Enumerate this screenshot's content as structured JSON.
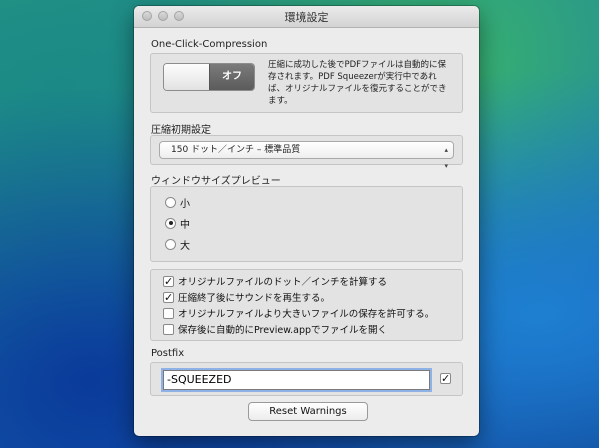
{
  "window": {
    "title": "環境設定"
  },
  "compression": {
    "label": "One-Click-Compression",
    "toggle_off": "オフ",
    "description_lines": [
      "圧縮に成功した後でPDFファイルは自動的に保",
      "存されます。PDF Squeezerが実行中であれ",
      "ば、オリジナルファイルを復元することができ",
      "ます。"
    ]
  },
  "initial": {
    "label": "圧縮初期設定",
    "selected": "150 ドット／インチ – 標準品質"
  },
  "preview": {
    "label": "ウィンドウサイズプレビュー",
    "options": [
      {
        "label": "小",
        "selected": false
      },
      {
        "label": "中",
        "selected": true
      },
      {
        "label": "大",
        "selected": false
      }
    ]
  },
  "options": [
    {
      "label": "オリジナルファイルのドット／インチを計算する",
      "checked": true
    },
    {
      "label": "圧縮終了後にサウンドを再生する。",
      "checked": true
    },
    {
      "label": "オリジナルファイルより大きいファイルの保存を許可する。",
      "checked": false
    },
    {
      "label": "保存後に自動的にPreview.appでファイルを開く",
      "checked": false
    }
  ],
  "postfix": {
    "label": "Postfix",
    "value": "-SQUEEZED",
    "checked": true
  },
  "reset_button": "Reset Warnings"
}
